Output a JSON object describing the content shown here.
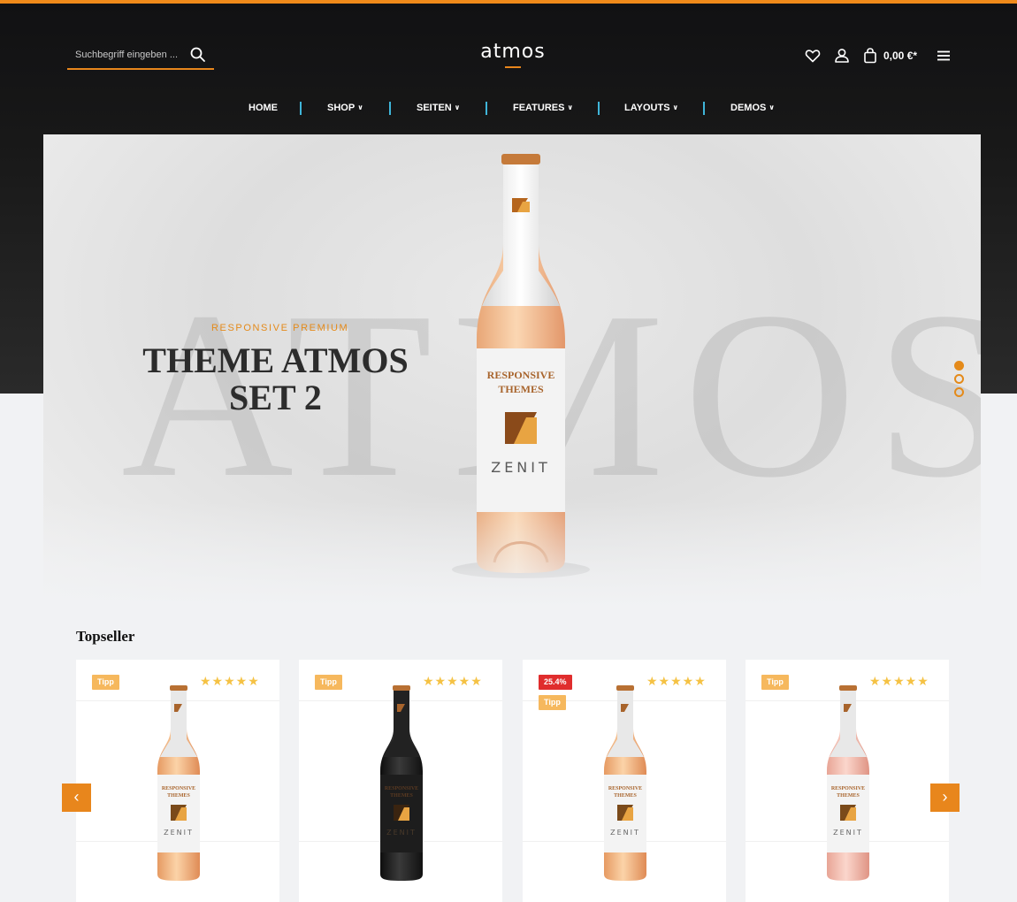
{
  "header": {
    "search_placeholder": "Suchbegriff eingeben ...",
    "logo": "atmos",
    "cart_total": "0,00 €*",
    "icons": [
      "heart-icon",
      "user-icon",
      "cart-bag-icon",
      "menu-icon"
    ]
  },
  "nav": {
    "items": [
      {
        "label": "HOME",
        "dropdown": false
      },
      {
        "label": "SHOP",
        "dropdown": true
      },
      {
        "label": "SEITEN",
        "dropdown": true
      },
      {
        "label": "FEATURES",
        "dropdown": true
      },
      {
        "label": "LAYOUTS",
        "dropdown": true
      },
      {
        "label": "DEMOS",
        "dropdown": true
      }
    ]
  },
  "hero": {
    "background_word": "ATMOS",
    "subtitle": "RESPONSIVE PREMIUM",
    "title_line1": "THEME ATMOS",
    "title_line2": "SET 2",
    "bottle_label_line1": "RESPONSIVE",
    "bottle_label_line2": "THEMES",
    "bottle_brand": "ZENIT",
    "slides": 3,
    "active_slide": 1
  },
  "topseller": {
    "title": "Topseller",
    "products": [
      {
        "badges": [
          "Tipp"
        ],
        "rating": 5,
        "wine": "rose-orange",
        "label_line1": "RESPONSIVE",
        "label_line2": "THEMES",
        "brand": "ZENIT"
      },
      {
        "badges": [
          "Tipp"
        ],
        "rating": 5,
        "wine": "red-dark",
        "label_line1": "RESPONSIVE",
        "label_line2": "THEMES",
        "brand": "ZENIT"
      },
      {
        "badges": [
          "25.4%",
          "Tipp"
        ],
        "rating": 5,
        "wine": "rose-orange",
        "label_line1": "RESPONSIVE",
        "label_line2": "THEMES",
        "brand": "ZENIT"
      },
      {
        "badges": [
          "Tipp"
        ],
        "rating": 5,
        "wine": "rose-pink",
        "label_line1": "RESPONSIVE",
        "label_line2": "THEMES",
        "brand": "ZENIT"
      }
    ]
  },
  "colors": {
    "accent": "#e8861c",
    "nav_separator": "#3fb5d9",
    "sale": "#e02d2d",
    "tipp": "#f6b85d",
    "stars": "#f5c244"
  }
}
